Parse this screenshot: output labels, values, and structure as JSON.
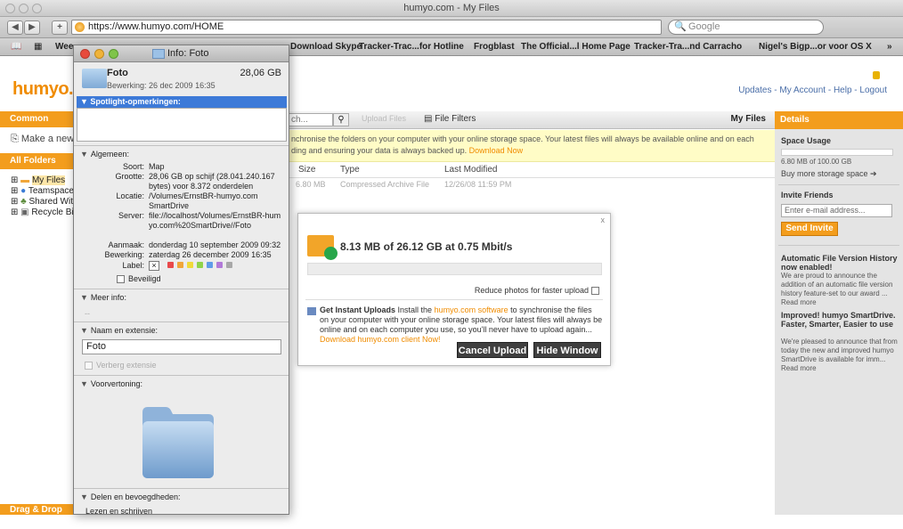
{
  "browser": {
    "window_title": "humyo.com - My Files",
    "url": "https://www.humyo.com/HOME",
    "search_placeholder": "Google",
    "bookmarks": [
      "Wee",
      "Download Skype",
      "Tracker-Trac...for Hotline",
      "Frogblast",
      "The Official...l Home Page",
      "Tracker-Tra...nd Carracho",
      "Nigel's Bigp...or voor OS X",
      "»"
    ]
  },
  "header": {
    "logo": "humyo.",
    "links": "Updates  -  My Account  -  Help  -  Logout"
  },
  "sidebar": {
    "common_tasks": "Common Tasks",
    "make_new": "Make a new",
    "all_folders": "All Folders",
    "folders": [
      "My Files",
      "Teamspace",
      "Shared With",
      "Recycle Bin"
    ],
    "drag_drop": "Drag & Drop Up"
  },
  "main": {
    "search_value": "ch...",
    "upload_files": "Upload Files",
    "file_filters": "File Filters",
    "my_files": "My Files",
    "notice": "nchronise the folders on your computer with your online storage space. Your latest files will always be available online and on each",
    "notice2": "ding and ensuring your data is always backed up.",
    "notice_link": "Download Now",
    "columns": [
      "Size",
      "Type",
      "Last Modified"
    ],
    "rows": [
      {
        "size": "6.80 MB",
        "type": "Compressed Archive File",
        "modified": "12/26/08 11:59 PM"
      }
    ]
  },
  "upload_dialog": {
    "close": "x",
    "rate": "8.13 MB of 26.12 GB at 0.75 Mbit/s",
    "progress": 0.0,
    "reduce": "Reduce photos for faster upload",
    "instant_title": "Get Instant Uploads",
    "instant_text1": "Install the",
    "instant_link1": "humyo.com software",
    "instant_text2": "to synchronise the files on your computer with your online storage space. Your latest files will always be online and on each computer you use, so you'll never have to upload again...",
    "instant_link2": "Download humyo.com client Now!",
    "cancel": "Cancel Upload",
    "hide": "Hide Window"
  },
  "details": {
    "title": "Details",
    "space_usage": "Space Usage",
    "usage_text": "6.80 MB of 100.00 GB",
    "buy_more": "Buy more storage space  ➔",
    "invite": "Invite Friends",
    "email_placeholder": "Enter e-mail address...",
    "send": "Send Invite",
    "news1_title": "Automatic File Version History now enabled!",
    "news1_text": "We are proud to announce the addition of an automatic file version history feature-set to our award ... Read more",
    "news2_title": "Improved! humyo SmartDrive. Faster, Smarter, Easier to use",
    "news2_text": "We're pleased to announce that from today the new and improved humyo SmartDrive is available for imm... Read more"
  },
  "info_window": {
    "title": "Info: Foto",
    "name": "Foto",
    "size": "28,06 GB",
    "edited": "Bewerking:  26 dec 2009 16:35",
    "spotlight": "Spotlight-opmerkingen:",
    "general": "Algemeen:",
    "kind_k": "Soort:",
    "kind_v": "Map",
    "size_k": "Grootte:",
    "size_v": "28,06 GB op schijf (28.041.240.167 bytes) voor 8.372 onderdelen",
    "loc_k": "Locatie:",
    "loc_v": "/Volumes/ErnstBR-humyo.com SmartDrive",
    "server_k": "Server:",
    "server_v": "file://localhost/Volumes/ErnstBR-humyo.com%20SmartDrive//Foto",
    "created_k": "Aanmaak:",
    "created_v": "donderdag 10 september 2009 09:32",
    "modified_k": "Bewerking:",
    "modified_v": "zaterdag 26 december 2009 16:35",
    "label_k": "Label:",
    "label_colors": [
      "#e8494b",
      "#f0a63a",
      "#f0da3a",
      "#8fd34a",
      "#5f9ce8",
      "#b27ad8",
      "#a8a8a8"
    ],
    "locked": "Beveiligd",
    "more_info": "Meer info:",
    "more_info_val": "--",
    "name_ext": "Naam en extensie:",
    "name_value": "Foto",
    "hide_ext": "Verberg extensie",
    "preview": "Voorvertoning:",
    "sharing": "Delen en bevoegdheden:",
    "sharing_val": "Lezen en schrijven"
  }
}
